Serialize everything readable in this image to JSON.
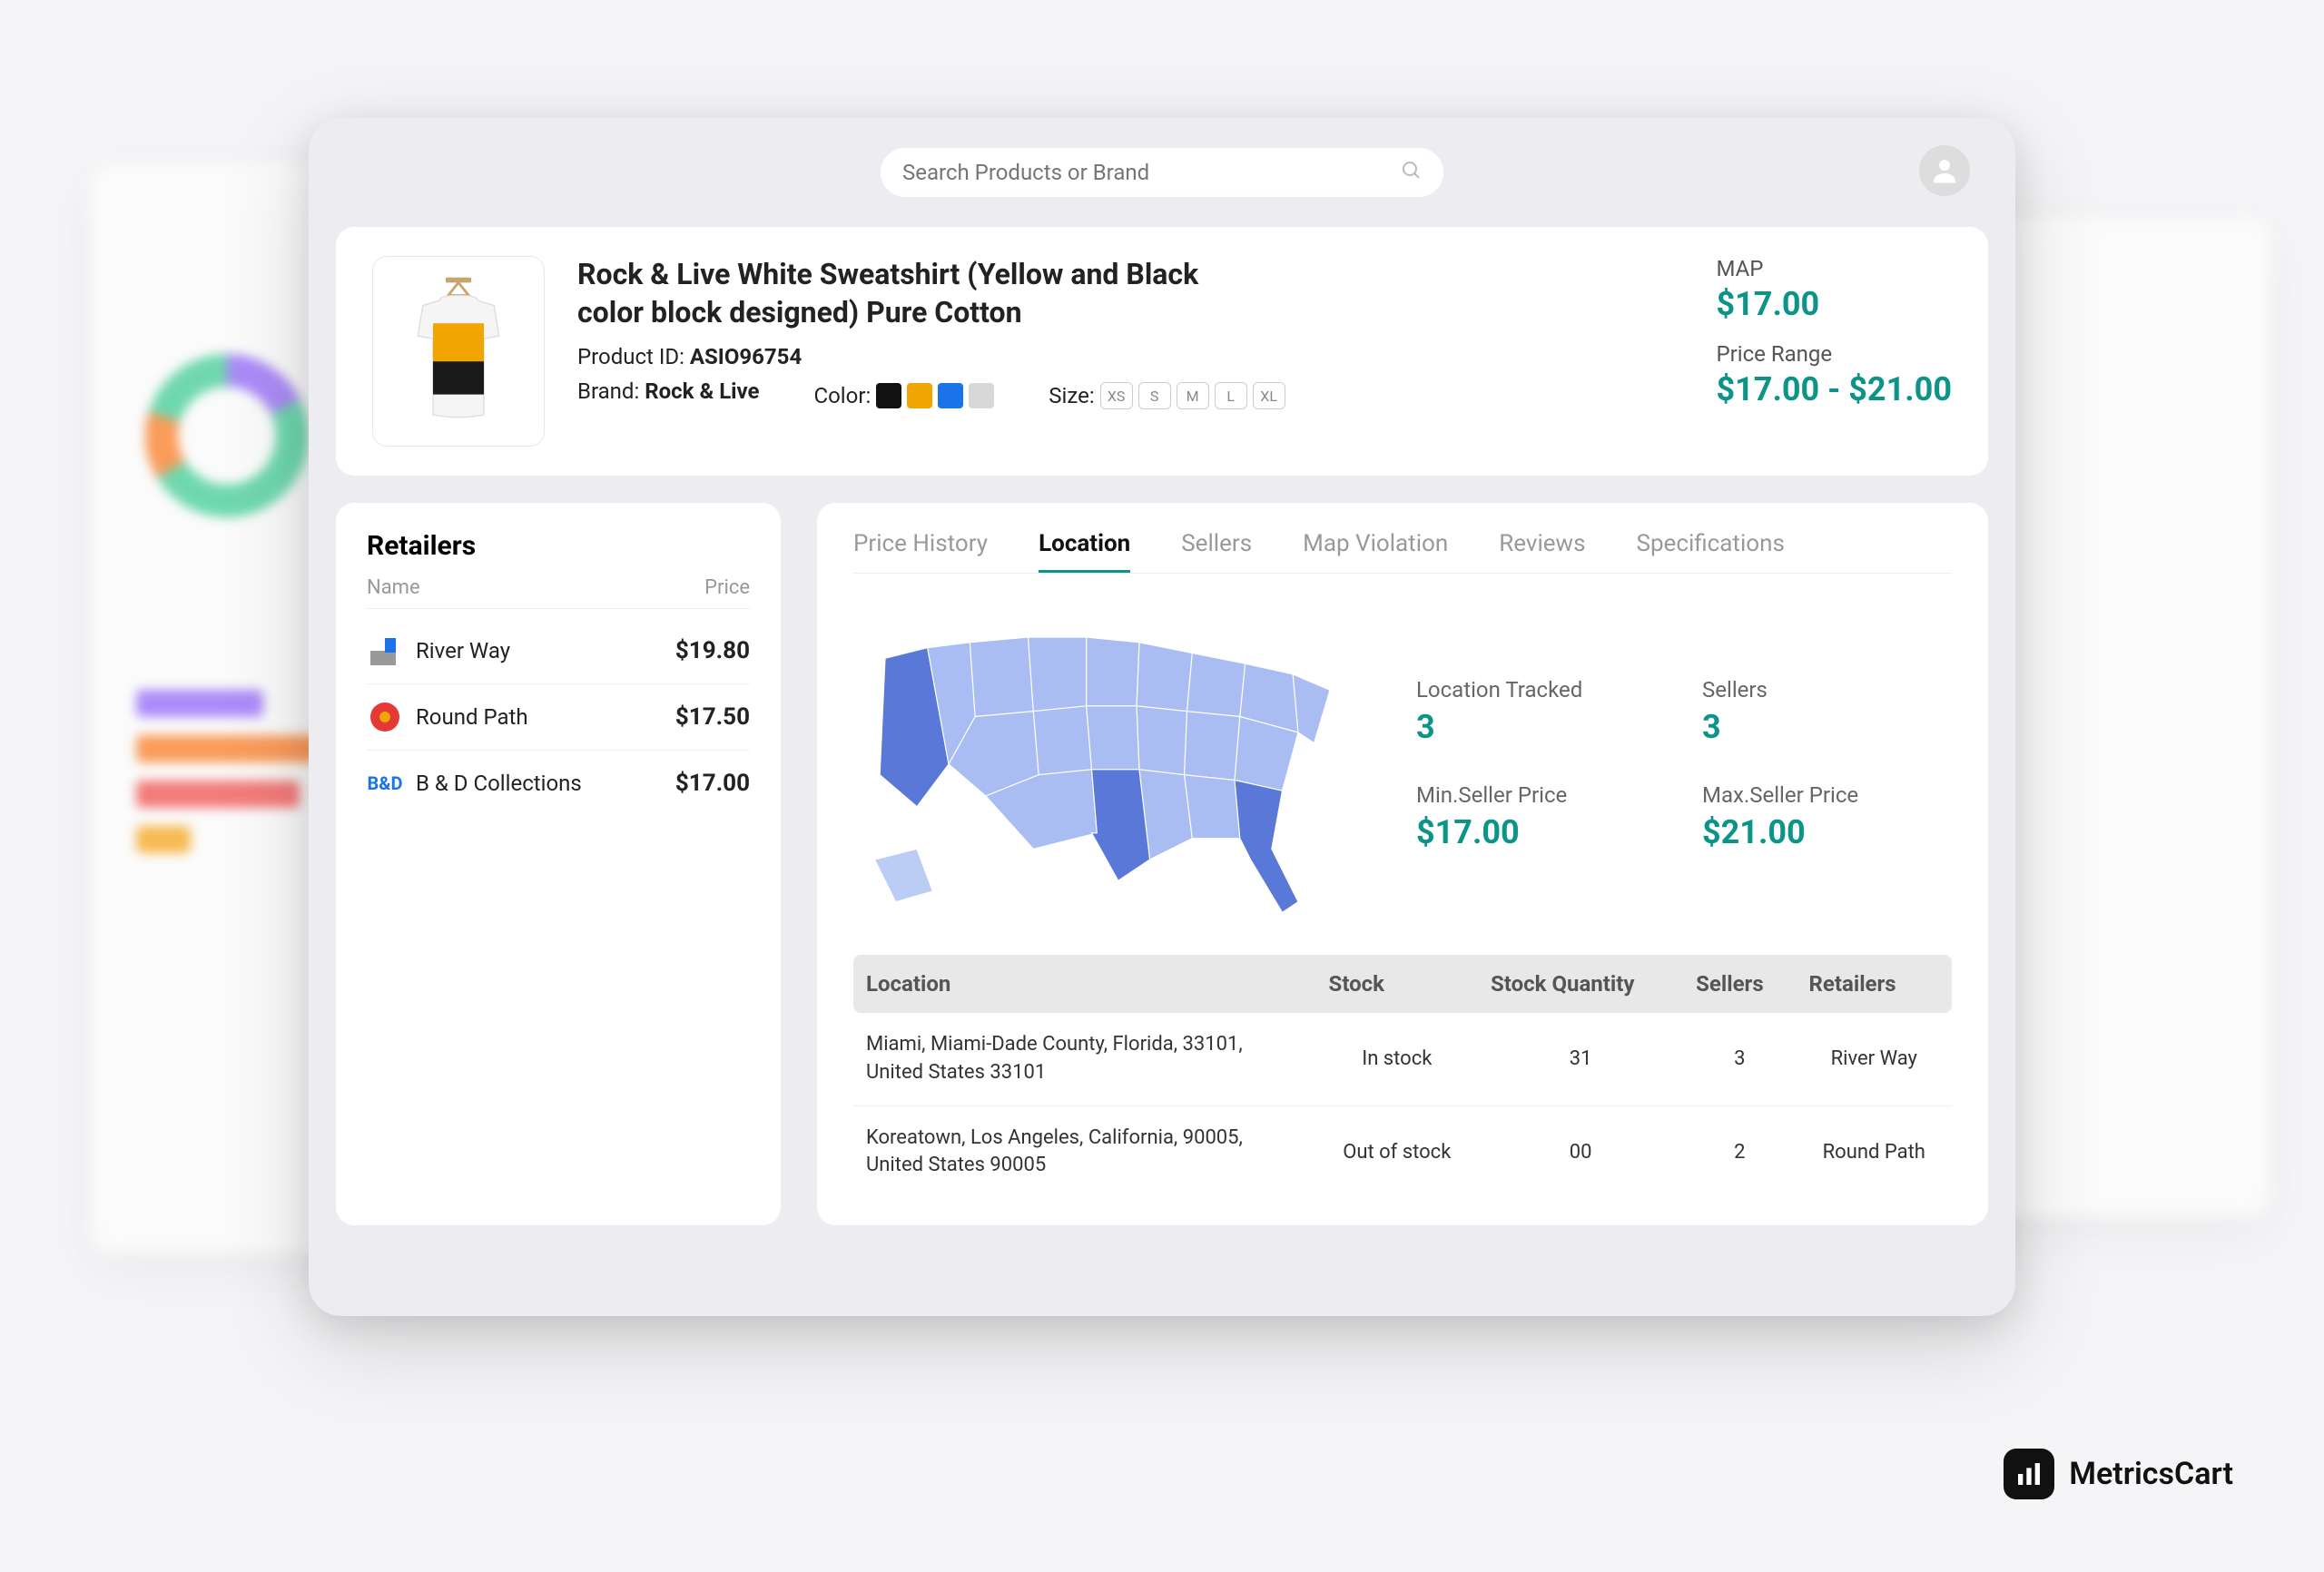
{
  "search": {
    "placeholder": "Search Products or Brand"
  },
  "product": {
    "title": "Rock & Live White Sweatshirt (Yellow and Black color block designed) Pure Cotton",
    "id_label": "Product ID:",
    "id": "ASIO96754",
    "brand_label": "Brand:",
    "brand": "Rock & Live",
    "color_label": "Color:",
    "colors": [
      "#111111",
      "#f0a500",
      "#1a73e8",
      "#d8d8d8"
    ],
    "size_label": "Size:",
    "sizes": [
      "XS",
      "S",
      "M",
      "L",
      "XL"
    ],
    "map_label": "MAP",
    "map_value": "$17.00",
    "range_label": "Price Range",
    "range_value": "$17.00 - $21.00"
  },
  "retailers": {
    "title": "Retailers",
    "head_name": "Name",
    "head_price": "Price",
    "items": [
      {
        "name": "River Way",
        "price": "$19.80",
        "logo_text": ""
      },
      {
        "name": "Round Path",
        "price": "$17.50",
        "logo_text": ""
      },
      {
        "name": "B & D Collections",
        "price": "$17.00",
        "logo_text": "B&D"
      }
    ]
  },
  "tabs": {
    "items": [
      {
        "label": "Price History",
        "active": false
      },
      {
        "label": "Location",
        "active": true
      },
      {
        "label": "Sellers",
        "active": false
      },
      {
        "label": "Map Violation",
        "active": false
      },
      {
        "label": "Reviews",
        "active": false
      },
      {
        "label": "Specifications",
        "active": false
      }
    ]
  },
  "stats": {
    "loc_tracked_label": "Location Tracked",
    "loc_tracked": "3",
    "sellers_label": "Sellers",
    "sellers": "3",
    "min_label": "Min.Seller Price",
    "min": "$17.00",
    "max_label": "Max.Seller Price",
    "max": "$21.00"
  },
  "table": {
    "headers": {
      "location": "Location",
      "stock": "Stock",
      "qty": "Stock Quantity",
      "sellers": "Sellers",
      "retailers": "Retailers"
    },
    "rows": [
      {
        "location": "Miami, Miami-Dade County, Florida, 33101, United States 33101",
        "stock": "In stock",
        "stock_class": "stock-in",
        "qty": "31",
        "sellers": "3",
        "retailers": "River Way"
      },
      {
        "location": "Koreatown, Los Angeles, California, 90005, United States 90005",
        "stock": "Out of stock",
        "stock_class": "stock-out",
        "qty": "00",
        "sellers": "2",
        "retailers": "Round Path"
      }
    ]
  },
  "brand": {
    "name": "MetricsCart"
  }
}
